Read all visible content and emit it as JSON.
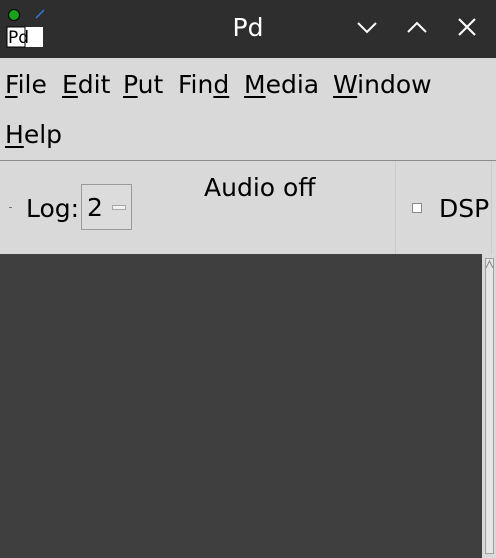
{
  "window": {
    "title": "Pd",
    "icon_text": "Pd",
    "controls": [
      "minimize-icon",
      "maximize-icon",
      "close-icon"
    ]
  },
  "menu": {
    "items": [
      {
        "label": "File",
        "mnemonic": "F"
      },
      {
        "label": "Edit",
        "mnemonic": "E"
      },
      {
        "label": "Put",
        "mnemonic": "P"
      },
      {
        "label": "Find",
        "mnemonic": "d"
      },
      {
        "label": "Media",
        "mnemonic": "M"
      },
      {
        "label": "Window",
        "mnemonic": "W"
      },
      {
        "label": "Help",
        "mnemonic": "H"
      }
    ]
  },
  "status": {
    "log_label": "Log:",
    "log_level": "2",
    "audio_status": "Audio off",
    "dsp_label": "DSP",
    "dsp_checked": false
  },
  "colors": {
    "titlebar_bg": "#2e2e2e",
    "menubar_bg": "#d9d9d9",
    "console_bg": "#3f3f3f",
    "icon_green": "#1aa31a"
  }
}
